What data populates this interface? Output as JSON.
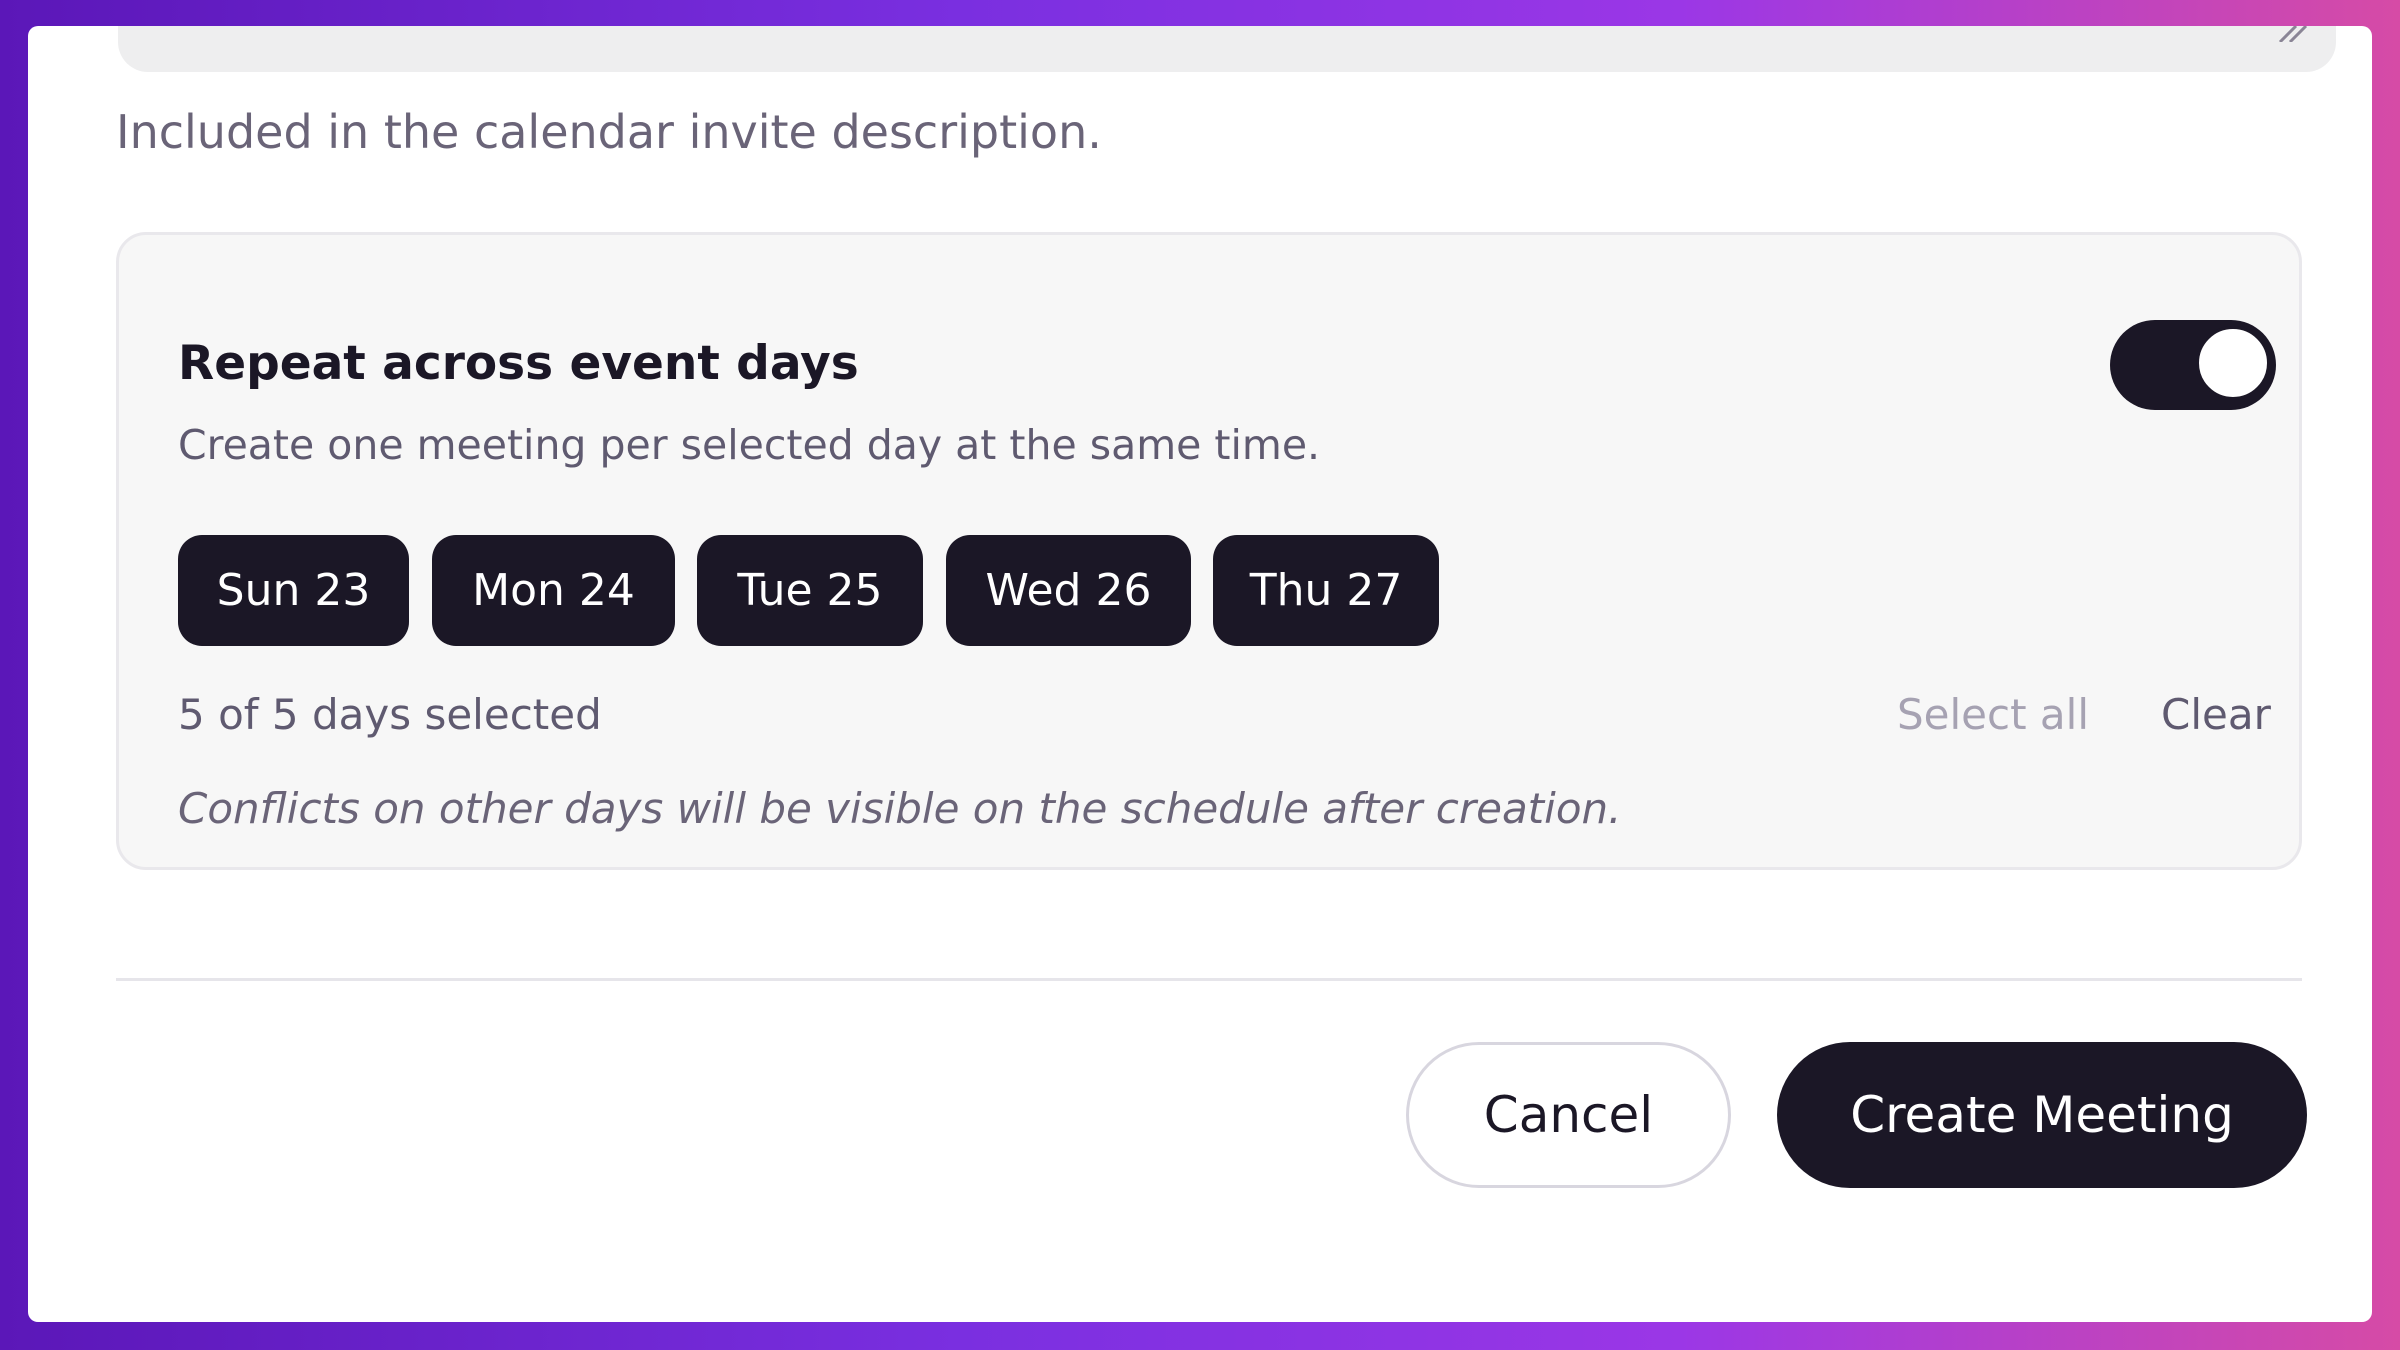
{
  "description_field": {
    "helper_text": "Included in the calendar invite description."
  },
  "repeat_section": {
    "title": "Repeat across event days",
    "subtitle": "Create one meeting per selected day at the same time.",
    "toggle_on": true,
    "days": [
      {
        "label": "Sun 23",
        "selected": true
      },
      {
        "label": "Mon 24",
        "selected": true
      },
      {
        "label": "Tue 25",
        "selected": true
      },
      {
        "label": "Wed 26",
        "selected": true
      },
      {
        "label": "Thu 27",
        "selected": true
      }
    ],
    "selection_count": "5 of 5 days selected",
    "select_all_label": "Select all",
    "clear_label": "Clear",
    "conflict_note": "Conflicts on other days will be visible on the schedule after creation."
  },
  "footer": {
    "cancel_label": "Cancel",
    "create_label": "Create Meeting"
  },
  "colors": {
    "primary": "#1b1726",
    "muted_text": "#5f5a70",
    "disabled_text": "#a6a2b2",
    "card_background": "#f7f7f7"
  }
}
